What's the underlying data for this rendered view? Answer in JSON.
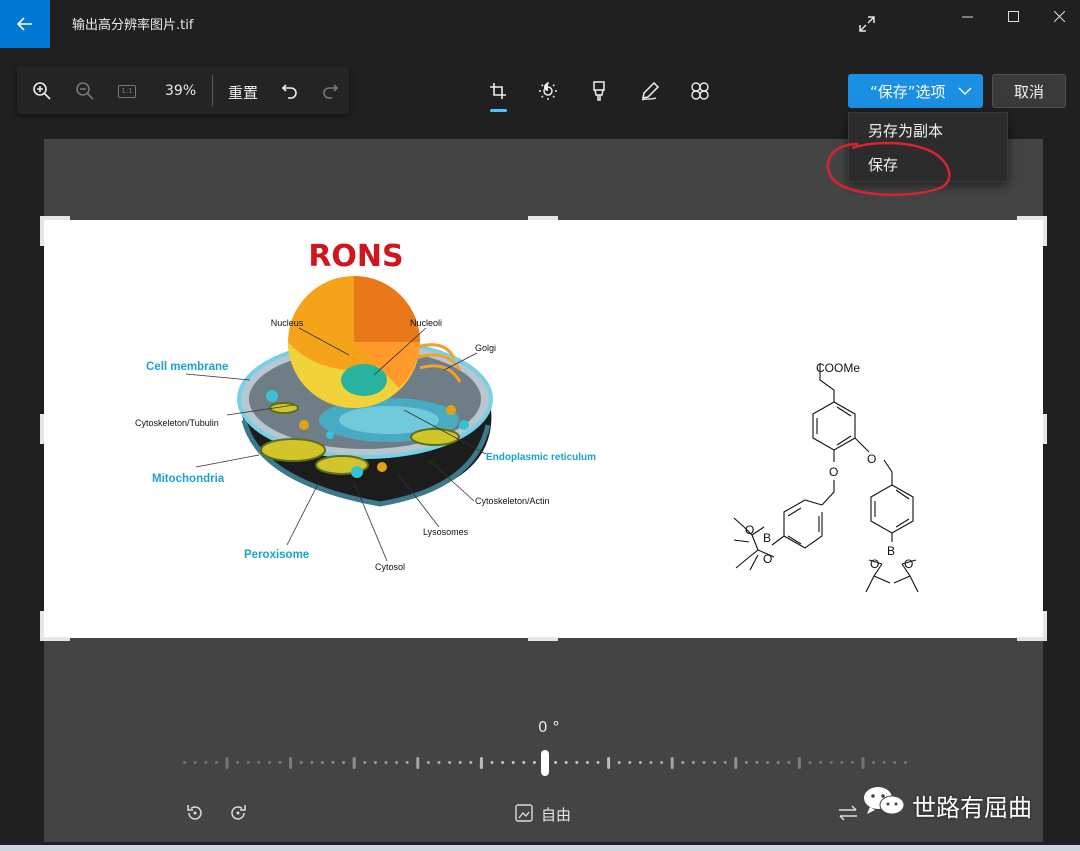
{
  "titlebar": {
    "file_name": "输出高分辨率图片.tif",
    "back_icon": "arrow-left-icon",
    "expand_icon": "expand-diagonal-icon",
    "window_controls": [
      "minimize-icon",
      "maximize-icon",
      "close-icon"
    ]
  },
  "zoom_toolbar": {
    "zoom_in_icon": "zoom-in-icon",
    "zoom_out_icon": "zoom-out-icon",
    "actual_size_icon": "actual-size-icon",
    "actual_size_text": "1:1",
    "zoom_percent": "39%",
    "reset_label": "重置",
    "undo_icon": "undo-icon",
    "redo_icon": "redo-icon"
  },
  "tools": [
    {
      "icon": "crop-icon",
      "active": true
    },
    {
      "icon": "brightness-icon",
      "active": false
    },
    {
      "icon": "filter-icon",
      "active": false
    },
    {
      "icon": "markup-pen-icon",
      "active": false
    },
    {
      "icon": "retouch-icon",
      "active": false
    }
  ],
  "actions": {
    "save_options_label": "“保存”选项",
    "cancel_label": "取消",
    "save_menu": [
      {
        "label": "另存为副本"
      },
      {
        "label": "保存"
      }
    ]
  },
  "image": {
    "title": "RONS",
    "cell_labels": {
      "nucleus": "Nucleus",
      "nucleoli": "Nucleoli",
      "golgi": "Golgi",
      "cell_membrane": "Cell membrane",
      "cytoskeleton_tubulin": "Cytoskeleton/Tubulin",
      "mitochondria": "Mitochondria",
      "endoplasmic_reticulum": "Endoplasmic reticulum",
      "cytoskeleton_actin": "Cytoskeleton/Actin",
      "lysosomes": "Lysosomes",
      "peroxisome": "Peroxisome",
      "cytosol": "Cytosol"
    },
    "molecule_labels": {
      "ester": "COOMe",
      "oxygen": "O",
      "boron": "B"
    }
  },
  "bottom_controls": {
    "angle": "0 °",
    "straighten_value_deg": 0,
    "rotate_left_icon": "rotate-left-icon",
    "rotate_right_icon": "rotate-right-icon",
    "aspect_icon": "aspect-ratio-icon",
    "aspect_label": "自由",
    "flip_icon": "flip-icon"
  },
  "watermark": {
    "text": "世路有屈曲",
    "icon": "wechat-icon"
  },
  "colors": {
    "accent": "#0078d4",
    "save_button": "#1a8fe3",
    "annotation_red": "#d9232d",
    "label_cyan": "#1aa3c9",
    "title_red": "#d0151c"
  }
}
